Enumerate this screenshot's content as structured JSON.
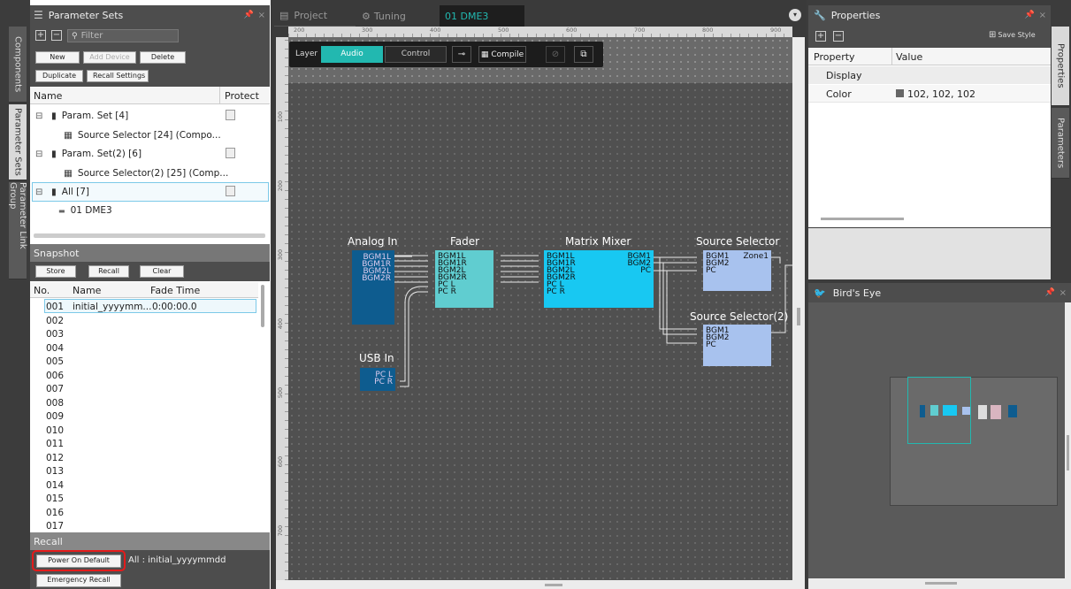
{
  "left_panel": {
    "title": "Parameter Sets",
    "filter_placeholder": "Filter",
    "buttons": {
      "new": "New",
      "add_device": "Add Device",
      "delete": "Delete",
      "duplicate": "Duplicate",
      "recall_settings": "Recall Settings"
    },
    "columns": {
      "name": "Name",
      "protect": "Protect"
    },
    "tree": [
      {
        "label": "Param. Set [4]"
      },
      {
        "label": "Source Selector [24] (Compo..."
      },
      {
        "label": "Param. Set(2) [6]"
      },
      {
        "label": "Source Selector(2) [25] (Comp..."
      },
      {
        "label": "All [7]"
      },
      {
        "label": "01 DME3"
      }
    ]
  },
  "side_tabs": {
    "components": "Components",
    "parameter_sets": "Parameter Sets",
    "parameter_link_group": "Parameter Link Group"
  },
  "snapshot": {
    "title": "Snapshot",
    "buttons": {
      "store": "Store",
      "recall": "Recall",
      "clear": "Clear"
    },
    "columns": {
      "no": "No.",
      "name": "Name",
      "fade": "Fade Time"
    },
    "rows": [
      {
        "no": "001",
        "name": "initial_yyyymm...",
        "fade": "0:00:00.0"
      },
      {
        "no": "002"
      },
      {
        "no": "003"
      },
      {
        "no": "004"
      },
      {
        "no": "005"
      },
      {
        "no": "006"
      },
      {
        "no": "007"
      },
      {
        "no": "008"
      },
      {
        "no": "009"
      },
      {
        "no": "010"
      },
      {
        "no": "011"
      },
      {
        "no": "012"
      },
      {
        "no": "013"
      },
      {
        "no": "014"
      },
      {
        "no": "015"
      },
      {
        "no": "016"
      },
      {
        "no": "017"
      }
    ]
  },
  "recall": {
    "title": "Recall",
    "power_on": "Power On Default",
    "power_on_value": "All : initial_yyyymmdd",
    "emergency": "Emergency Recall"
  },
  "tabs": {
    "project": "Project",
    "tuning": "Tuning",
    "dme": "01 DME3"
  },
  "toolbar": {
    "layer": "Layer",
    "audio": "Audio",
    "control": "Control",
    "compile": "Compile"
  },
  "ruler": {
    "top": [
      "200",
      "300",
      "400",
      "500",
      "600",
      "700",
      "800",
      "900"
    ],
    "left": [
      "100",
      "200",
      "300",
      "400",
      "500",
      "600",
      "700"
    ]
  },
  "blocks": {
    "analog_in": {
      "title": "Analog In",
      "ports": [
        "BGM1L",
        "BGM1R",
        "BGM2L",
        "BGM2R"
      ]
    },
    "fader": {
      "title": "Fader",
      "ports": [
        "BGM1L",
        "BGM1R",
        "BGM2L",
        "BGM2R",
        "PC L",
        "PC R"
      ]
    },
    "matrix": {
      "title": "Matrix Mixer",
      "ports": [
        "BGM1L",
        "BGM1R",
        "BGM2L",
        "BGM2R",
        "PC L",
        "PC R"
      ],
      "outs": [
        "BGM1",
        "BGM2",
        "PC"
      ]
    },
    "source_selector": {
      "title": "Source Selector",
      "ports": [
        "BGM1",
        "BGM2",
        "PC"
      ],
      "out": "Zone1"
    },
    "source_selector2": {
      "title": "Source Selector(2)",
      "ports": [
        "BGM1",
        "BGM2",
        "PC"
      ]
    },
    "usb_in": {
      "title": "USB In",
      "ports": [
        "PC L",
        "PC R"
      ]
    }
  },
  "properties": {
    "title": "Properties",
    "save_style": "Save Style",
    "columns": {
      "property": "Property",
      "value": "Value"
    },
    "section": "Display",
    "row_label": "Color",
    "row_value": "102, 102, 102",
    "color_swatch": "#666666"
  },
  "right_tabs": {
    "properties": "Properties",
    "parameters": "Parameters"
  },
  "birds_eye": {
    "title": "Bird's Eye"
  },
  "colors": {
    "accent": "#22b8b0",
    "analog": "#0e5c8f",
    "fader": "#60cdd0",
    "matrix": "#18c8f2",
    "selector": "#a8c2ee",
    "highlight": "#e41b1b"
  }
}
